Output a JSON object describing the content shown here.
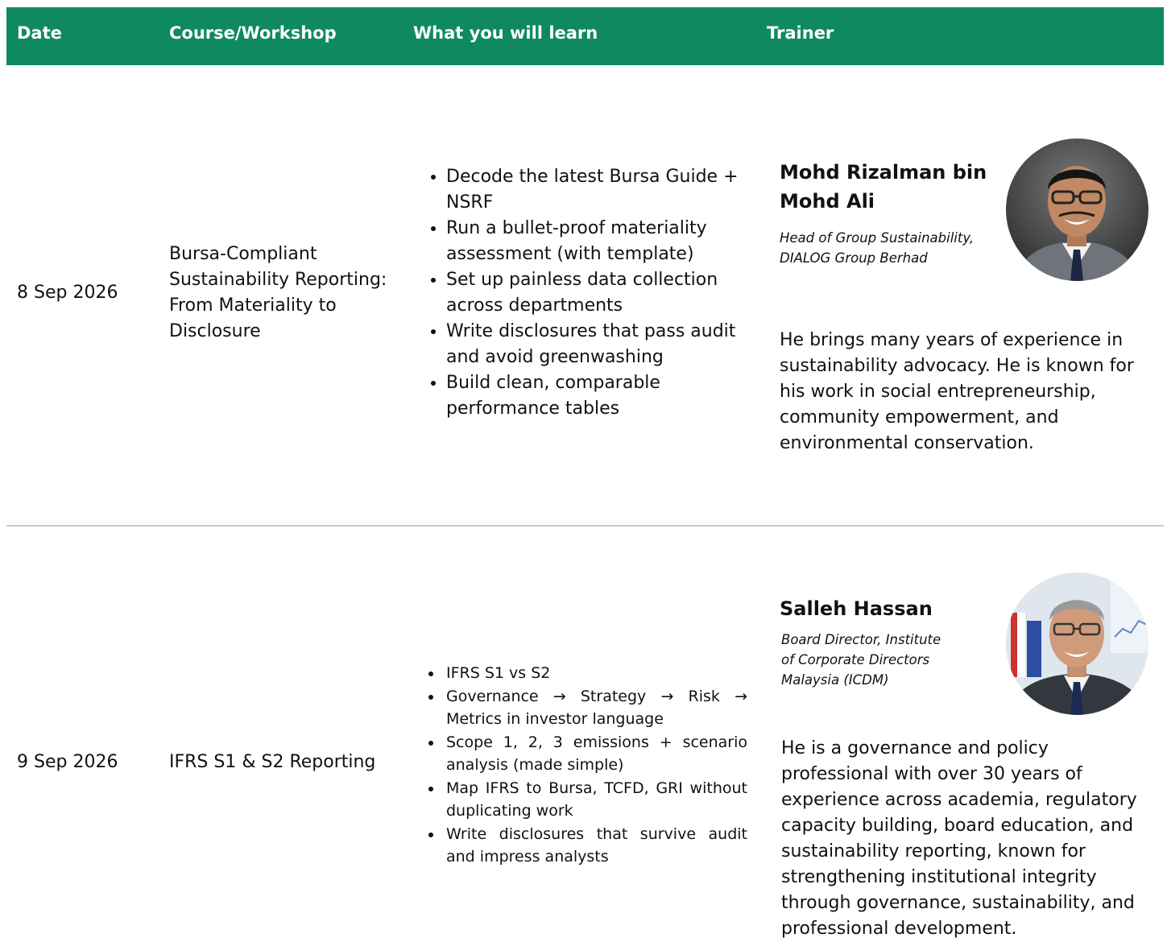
{
  "header": {
    "date": "Date",
    "course": "Course/Workshop",
    "learn": "What you will learn",
    "trainer": "Trainer"
  },
  "rows": [
    {
      "date": "8 Sep 2026",
      "course": "Bursa-Compliant Sustainability Reporting: From Materiality to Disclosure",
      "learn": [
        "Decode the latest Bursa Guide + NSRF",
        "Run a bullet-proof materiality assessment (with template)",
        "Set up painless data collection across departments",
        "Write disclosures that pass audit and avoid greenwashing",
        "Build clean, comparable performance tables"
      ],
      "trainer": {
        "name_line1": "Mohd Rizalman bin",
        "name_line2": "Mohd Ali",
        "role_line1": "Head of Group Sustainability,",
        "role_line2": "DIALOG Group Berhad",
        "bio": "He brings many years of experience in sustainability advocacy. He is known for his work in social entrepreneurship, community empowerment, and environmental conservation."
      }
    },
    {
      "date": "9 Sep 2026",
      "course": "IFRS S1 & S2 Reporting",
      "learn": [
        "IFRS S1 vs S2",
        "Governance → Strategy → Risk → Metrics in investor language",
        "Scope 1, 2, 3 emissions + scenario analysis (made simple)",
        "Map IFRS to Bursa, TCFD, GRI without duplicating work",
        "Write disclosures that survive audit and impress analysts"
      ],
      "trainer": {
        "name": "Salleh Hassan",
        "role_line1": "Board Director, Institute",
        "role_line2": "of Corporate Directors",
        "role_line3": "Malaysia (ICDM)",
        "bio": "He is a governance and policy professional with over 30 years of experience across academia, regulatory capacity building, board education, and sustainability reporting, known for strengthening institutional integrity through governance, sustainability, and professional development."
      }
    }
  ]
}
